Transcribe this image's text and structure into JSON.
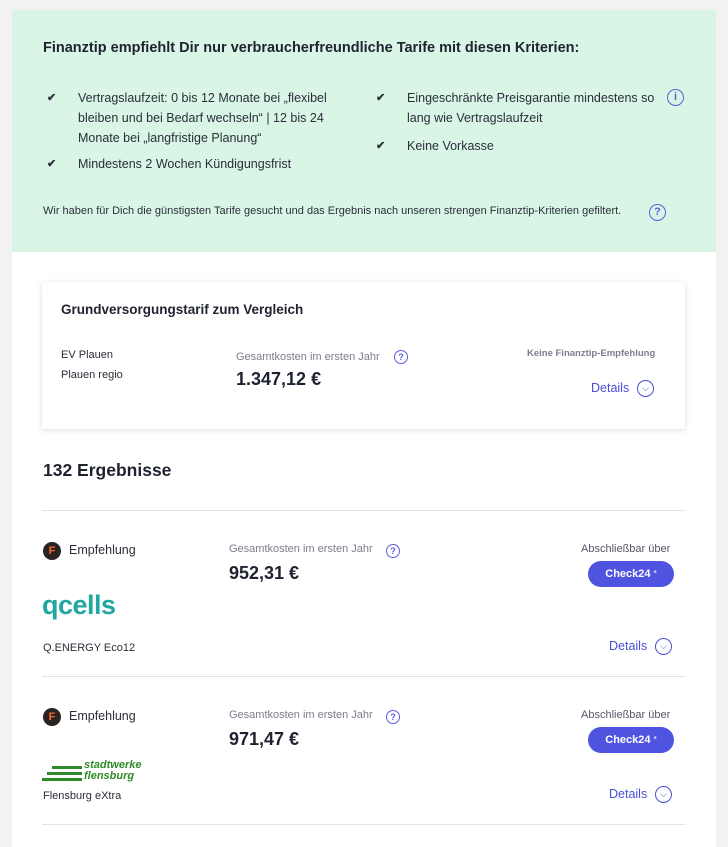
{
  "criteria": {
    "title": "Finanztip empfiehlt Dir nur verbraucherfreundliche Tarife mit diesen Kriterien:",
    "left": [
      [
        "Vertragslaufzeit: 0 bis 12 Monate bei „flexibel",
        "bleiben und bei Bedarf wechseln“ | 12 bis 24",
        "Monate bei „langfristige Planung“"
      ],
      [
        "Mindestens 2 Wochen Kündigungsfrist"
      ]
    ],
    "right": [
      [
        "Eingeschränkte Preisgarantie mindestens so",
        "lang wie Vertragslaufzeit"
      ],
      [
        "Keine Vorkasse"
      ]
    ],
    "check_symbol": "✔",
    "info_symbol": "i",
    "filter_note": "Wir haben für Dich die günstigsten Tarife gesucht und das Ergebnis nach unseren strengen Finanztip-Kriterien gefiltert.",
    "help_symbol": "?"
  },
  "base_tariff": {
    "title": "Grundversorgungstarif zum Vergleich",
    "provider": "EV Plauen",
    "tariff": "Plauen regio",
    "cost_label": "Gesamtkosten im ersten Jahr",
    "cost": "1.347,12 €",
    "no_recommendation": "Keine Finanztip-Empfehlung",
    "details_label": "Details"
  },
  "results": {
    "count_label": "132 Ergebnisse",
    "items": [
      {
        "badge_letter": "F",
        "recommendation_label": "Empfehlung",
        "cost_label": "Gesamtkosten im ersten Jahr",
        "cost": "952,31 €",
        "closable_label": "Abschließbar über",
        "cta_label": "Check24",
        "cta_mark": "*",
        "logo_text": "qcells",
        "tariff_name": "Q.ENERGY Eco12",
        "details_label": "Details"
      },
      {
        "badge_letter": "F",
        "recommendation_label": "Empfehlung",
        "cost_label": "Gesamtkosten im ersten Jahr",
        "cost": "971,47 €",
        "closable_label": "Abschließbar über",
        "cta_label": "Check24",
        "cta_mark": "*",
        "logo_lines": [
          "stadtwerke",
          "flensburg"
        ],
        "tariff_name": "Flensburg eXtra",
        "details_label": "Details"
      }
    ]
  },
  "colors": {
    "criteria_bg": "#d8f5e6",
    "accent": "#4f54e0",
    "qcells_blue": "#2c3e8f",
    "qcells_teal": "#1fa7a0",
    "flensburg_green": "#2f8a2a",
    "finanztip_orange": "#ff6a2b"
  }
}
